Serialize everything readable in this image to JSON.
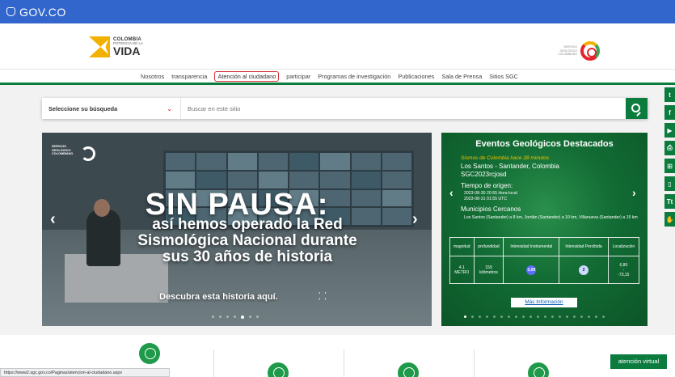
{
  "gov_bar": {
    "label": "GOV.CO",
    "color": "#3366cc"
  },
  "brand": {
    "line1": "COLOMBIA",
    "line2": "POTENCIA DE LA",
    "line3": "VIDA"
  },
  "sgc_logo": {
    "text": "SERVICIO GEOLÓGICO COLOMBIANO"
  },
  "nav": {
    "items": [
      "Nosotros",
      "transparencia",
      "Atención al ciudadano",
      "participar",
      "Programas de investigación",
      "Publicaciones",
      "Sala de Prensa",
      "Sitios SGC"
    ],
    "highlighted": "Atención al ciudadano"
  },
  "search": {
    "select_label": "Seleccione su búsqueda",
    "placeholder": "Buscar en este sitio"
  },
  "social": {
    "icons": [
      "twitter-icon",
      "facebook-icon",
      "youtube-icon",
      "print-icon",
      "sitemap-icon",
      "document-icon",
      "text-size-icon",
      "accessibility-icon"
    ],
    "glyphs": [
      "t",
      "f",
      "▶",
      "⎙",
      "⊞",
      "▯",
      "Tt",
      "✋"
    ]
  },
  "hero": {
    "logo_text": "SERVICIO GEOLÓGICO COLOMBIANO",
    "title": "SIN PAUSA:",
    "subtitle_l1": "así hemos operado la Red",
    "subtitle_l2": "Sismológica Nacional durante",
    "subtitle_l3": "sus 30 años de historia",
    "cta": "Descubra esta historia aquí.",
    "prev": "‹",
    "next": "›"
  },
  "events": {
    "title": "Eventos Geológicos Destacados",
    "ago": "Sismos de Colombia  hace 28 minutos",
    "place": "Los Santos - Santander, Colombia",
    "id": "SGC2023rcjosd",
    "origin_label": "Tiempo de origen:",
    "origin_local": "2023-08-30 20:55 Hora local",
    "origin_utc": "2023-08-31 01:55 UTC",
    "nearby_label": "Municipios Cercanos",
    "nearby_text": "Los Santos (Santander) a 8 km, Jordán (Santander) a 10 km, Villanueva (Santander) a 15 km",
    "table_headers": [
      "magnitud",
      "profundidad",
      "Intensidad Instrumental",
      "Intensidad Percibida",
      "Localización"
    ],
    "magnitude": "4,1",
    "magnitude_type": "METRO",
    "depth": "159",
    "depth_unit": "kilómetros",
    "instrumental": "3,09",
    "perceived": "2",
    "lat": "6,80",
    "lon": "-73,15",
    "more": "Más Información",
    "prev": "‹",
    "next": "›"
  },
  "virtual": {
    "label": "atención virtual"
  },
  "status_bar": {
    "url": "https://www2.sgc.gov.co/Paginas/atencion-al-ciudadano.aspx"
  }
}
